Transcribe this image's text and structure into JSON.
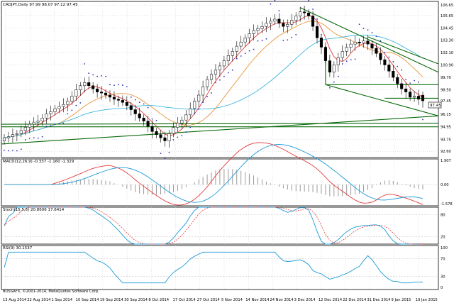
{
  "header": {
    "main": "CADJPY,Daily   97.99 98.07 97.12 97.45",
    "macd": "MACD(12,26,9) -0.337 -1.160 -1.329",
    "stoch": "Stoch(15,5,6) 20.8606 17.6414",
    "rsi": "RSI(9) 30.1537"
  },
  "footer": {
    "copyright": "BOSSAFX, ©2001-2014, MetaQuotes Software Corp."
  },
  "price_axis": {
    "labels": [
      "106.65",
      "105.65",
      "104.45",
      "103.30",
      "102.10",
      "100.90",
      "99.70",
      "98.50",
      "97.45",
      "96.15",
      "94.95",
      "93.75",
      "92.60"
    ],
    "current": "97.45"
  },
  "macd_axis": [
    "1.907",
    "0.00",
    "-1.578"
  ],
  "stoch_axis": [
    "80",
    "20"
  ],
  "rsi_axis": [
    "100",
    "70",
    "30",
    "0"
  ],
  "x_labels": [
    "13 Aug 2014",
    "22 Aug 2014",
    "1 Sep 2014",
    "10 Sep 2014",
    "19 Sep 2014",
    "30 Sep 2014",
    "8 Oct 2014",
    "17 Oct 2014",
    "27 Oct 2014",
    "5 Nov 2014",
    "14 Nov 2014",
    "24 Nov 2014",
    "3 Dec 2014",
    "12 Dec 2014",
    "22 Dec 2014",
    "31 Dec 2014",
    "9 Jan 2015",
    "19 Jan 2015"
  ],
  "colors": {
    "bull": "#ffffff",
    "bear": "#000000",
    "ma_fast": "#e23b3b",
    "ma_mid": "#e8943a",
    "ma_slow": "#3cb6e0",
    "psar": "#3030c0",
    "channel": "#0a6b0a",
    "hline": "#0a6b0a",
    "macd_main": "#e23b3b",
    "macd_signal": "#1a9ad6",
    "stoch_main": "#1a9ad6",
    "stoch_signal": "#e23b3b",
    "rsi": "#1a9ad6"
  },
  "chart_data": [
    {
      "type": "candlestick",
      "title": "CADJPY,Daily",
      "last_bar": {
        "open": 97.99,
        "high": 98.07,
        "low": 97.12,
        "close": 97.45
      },
      "ylim": [
        92.0,
        107.0
      ],
      "close_series": [
        93.9,
        94.0,
        94.2,
        94.3,
        94.6,
        94.9,
        95.2,
        95.4,
        95.5,
        95.8,
        96.2,
        96.4,
        96.7,
        96.9,
        97.1,
        97.4,
        97.9,
        98.5,
        98.9,
        99.2,
        98.9,
        98.6,
        98.3,
        98.2,
        98.0,
        97.8,
        97.6,
        97.5,
        97.3,
        97.0,
        96.6,
        96.2,
        95.8,
        95.5,
        95.0,
        94.5,
        94.2,
        93.9,
        93.6,
        94.3,
        94.9,
        95.3,
        95.6,
        96.1,
        96.7,
        97.4,
        98.0,
        98.8,
        99.5,
        100.0,
        100.4,
        100.8,
        101.3,
        101.8,
        102.2,
        102.7,
        103.1,
        103.5,
        103.9,
        104.2,
        104.4,
        104.6,
        104.9,
        105.1,
        105.3,
        104.9,
        104.6,
        104.8,
        105.2,
        105.6,
        106.0,
        105.9,
        105.6,
        104.6,
        103.5,
        102.6,
        101.3,
        100.2,
        100.9,
        101.6,
        102.2,
        102.6,
        102.9,
        103.1,
        103.0,
        103.2,
        102.9,
        102.5,
        102.0,
        101.4,
        100.9,
        100.3,
        99.7,
        99.1,
        98.6,
        98.3,
        97.8,
        97.9,
        97.6,
        97.45
      ]
    },
    {
      "type": "line",
      "name": "MACD(12,26,9)",
      "ylim": [
        -1.578,
        1.907
      ]
    },
    {
      "type": "line",
      "name": "Stoch(15,5,6)",
      "ylim": [
        0,
        100
      ]
    },
    {
      "type": "line",
      "name": "RSI(9)",
      "ylim": [
        0,
        100
      ]
    }
  ]
}
